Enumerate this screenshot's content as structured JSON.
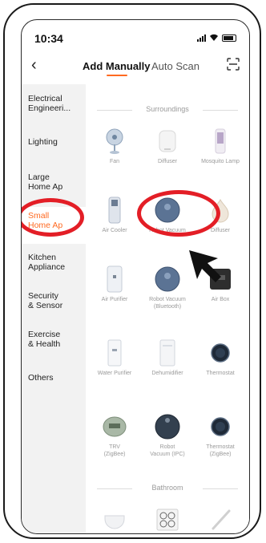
{
  "status_bar": {
    "time": "10:34"
  },
  "nav": {
    "back_icon": "chevron-left-icon",
    "tab_manual": "Add Manually",
    "tab_auto": "Auto Scan",
    "scan_icon": "scan-frame-icon",
    "accent_color": "#ff6a21"
  },
  "sidebar": {
    "items": [
      {
        "label": "Electrical\nEngineeri..."
      },
      {
        "label": "Lighting"
      },
      {
        "label": "Large\nHome Ap"
      },
      {
        "label": "Small\nHome Ap"
      },
      {
        "label": "Kitchen\nAppliance"
      },
      {
        "label": "Security\n& Sensor"
      },
      {
        "label": "Exercise\n& Health"
      },
      {
        "label": "Others"
      }
    ],
    "active_index": 3
  },
  "sections": [
    {
      "title": "Surroundings",
      "items": [
        {
          "label": "Fan",
          "icon": "fan-icon"
        },
        {
          "label": "Diffuser",
          "icon": "diffuser-icon"
        },
        {
          "label": "Mosquito Lamp",
          "icon": "mosquito-lamp-icon"
        },
        {
          "label": "Air Cooler",
          "icon": "air-cooler-icon"
        },
        {
          "label": "Robot Vacuum",
          "icon": "robot-vacuum-icon"
        },
        {
          "label": "Diffuser",
          "icon": "diffuser-icon"
        },
        {
          "label": "Air Purifier",
          "icon": "air-purifier-icon"
        },
        {
          "label": "Robot Vacuum\n(Bluetooth)",
          "icon": "robot-vacuum-icon"
        },
        {
          "label": "Air Box",
          "icon": "air-box-icon"
        },
        {
          "label": "Water Purifier",
          "icon": "water-purifier-icon"
        },
        {
          "label": "Dehumidifier",
          "icon": "dehumidifier-icon"
        },
        {
          "label": "Thermostat",
          "icon": "thermostat-icon"
        },
        {
          "label": "TRV\n(ZigBee)",
          "icon": "trv-icon"
        },
        {
          "label": "Robot\nVacuum (IPC)",
          "icon": "robot-vacuum-icon"
        },
        {
          "label": "Thermostat\n(ZigBee)",
          "icon": "thermostat-icon"
        }
      ]
    },
    {
      "title": "Bathroom",
      "items": [
        {
          "label": "",
          "icon": "smart-toilet-icon"
        },
        {
          "label": "",
          "icon": "bathroom-heater-icon"
        },
        {
          "label": "",
          "icon": "toothbrush-icon"
        }
      ]
    }
  ],
  "annotation": {
    "highlight_color": "#e31e26",
    "cursor_icon": "arrow-cursor-icon"
  }
}
